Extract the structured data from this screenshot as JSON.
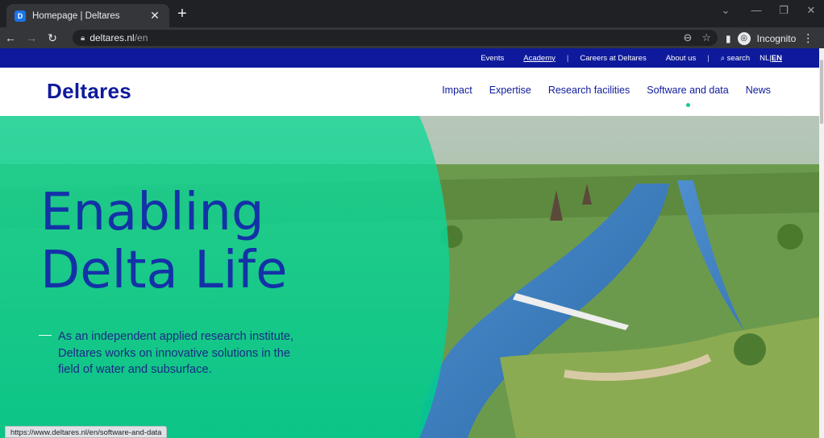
{
  "browser": {
    "tab_title": "Homepage | Deltares",
    "tab_favicon": "D",
    "url_host": "deltares.nl",
    "url_path": "/en",
    "incognito_label": "Incognito"
  },
  "utility_nav": {
    "links": [
      "Events",
      "Academy",
      "Careers at Deltares",
      "About us"
    ],
    "search_label": "search",
    "lang_nl": "NL",
    "lang_sep": "|",
    "lang_en": "EN"
  },
  "header": {
    "logo": "Deltares",
    "nav": [
      "Impact",
      "Expertise",
      "Research facilities",
      "Software and data",
      "News"
    ]
  },
  "hero": {
    "title_line1": "Enabling",
    "title_line2": "Delta Life",
    "text": "As an independent applied research institute, Deltares works on innovative solutions in the field of water and subsurface."
  },
  "status_bar": {
    "url": "https://www.deltares.nl/en/software-and-data"
  },
  "colors": {
    "brand_blue": "#0e1a9b",
    "accent_green": "#16c79a",
    "hero_overlay": "#0fd69a"
  },
  "icons": [
    "back-icon",
    "forward-icon",
    "reload-icon",
    "lock-icon",
    "zoom-icon",
    "star-icon",
    "sidepanel-icon",
    "incognito-icon",
    "menu-icon",
    "search-icon"
  ]
}
